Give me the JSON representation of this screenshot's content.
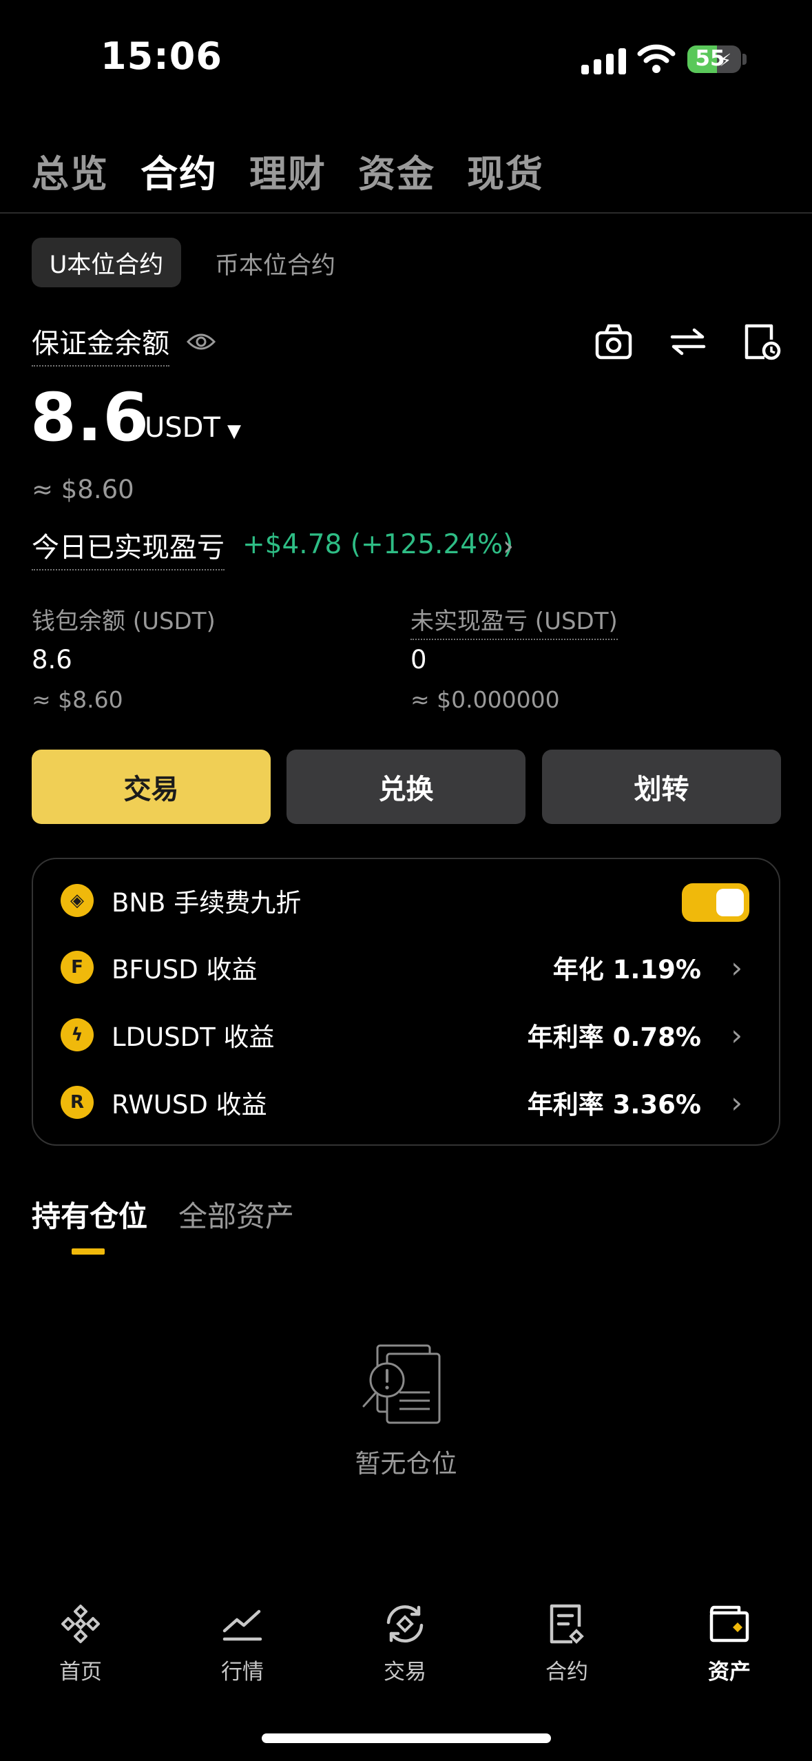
{
  "status_bar": {
    "time": "15:06",
    "battery": "55"
  },
  "top_tabs": [
    "总览",
    "合约",
    "理财",
    "资金",
    "现货"
  ],
  "sub_tabs": {
    "active": "U本位合约",
    "other": "币本位合约"
  },
  "balance": {
    "label": "保证金余额",
    "amount": "8.6",
    "unit": "USDT",
    "approx": "≈ $8.60",
    "pnl_label": "今日已实现盈亏",
    "pnl_value": "+$4.78 (+125.24%)"
  },
  "stats": {
    "wallet": {
      "label": "钱包余额 (USDT)",
      "value": "8.6",
      "approx": "≈ $8.60"
    },
    "unrealized": {
      "label": "未实现盈亏 (USDT)",
      "value": "0",
      "approx": "≈ $0.000000"
    }
  },
  "buttons": {
    "trade": "交易",
    "convert": "兑换",
    "transfer": "划转"
  },
  "card": {
    "rows": [
      {
        "label": "BNB 手续费九折",
        "toggle": true
      },
      {
        "label": "BFUSD 收益",
        "value": "年化 1.19%"
      },
      {
        "label": "LDUSDT 收益",
        "value": "年利率 0.78%"
      },
      {
        "label": "RWUSD 收益",
        "value": "年利率 3.36%"
      }
    ]
  },
  "holdings_tabs": {
    "active": "持有仓位",
    "other": "全部资产"
  },
  "empty_state": "暂无仓位",
  "bottom_nav": [
    "首页",
    "行情",
    "交易",
    "合约",
    "资产"
  ],
  "colors": {
    "accent": "#f0cf55",
    "positive": "#2ebd85",
    "muted": "#9a9a9a"
  }
}
